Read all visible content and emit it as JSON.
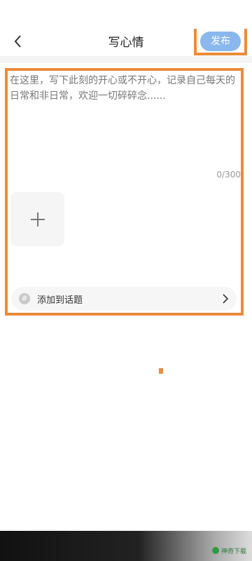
{
  "header": {
    "title": "写心情",
    "publish_label": "发布"
  },
  "editor": {
    "placeholder": "在这里，写下此刻的开心或不开心，记录自己每天的日常和非日常，欢迎一切碎碎念......",
    "counter": "0/300"
  },
  "topic": {
    "icon_glyph": "#",
    "label": "添加到话题"
  },
  "watermark": {
    "text": "神奇下载"
  },
  "colors": {
    "annotation_orange": "#e98c3c",
    "publish_button": "#8ab8ec"
  }
}
